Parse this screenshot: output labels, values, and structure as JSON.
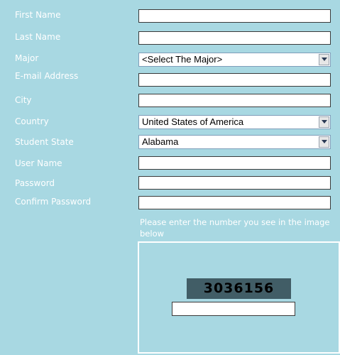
{
  "form": {
    "first_name_label": "First Name",
    "last_name_label": "Last Name",
    "major_label": "Major",
    "major_selected": "<Select The Major>",
    "email_label": "E-mail Address",
    "city_label": "City",
    "country_label": "Country",
    "country_selected": "United States of America",
    "state_label": "Student State",
    "state_selected": "Alabama",
    "username_label": "User Name",
    "password_label": "Password",
    "confirm_password_label": "Confirm Password"
  },
  "captcha": {
    "hint": "Please enter the number you see in the image below",
    "code": "3036156"
  },
  "icons": {
    "dropdown_arrow": "chevron-down-icon"
  }
}
